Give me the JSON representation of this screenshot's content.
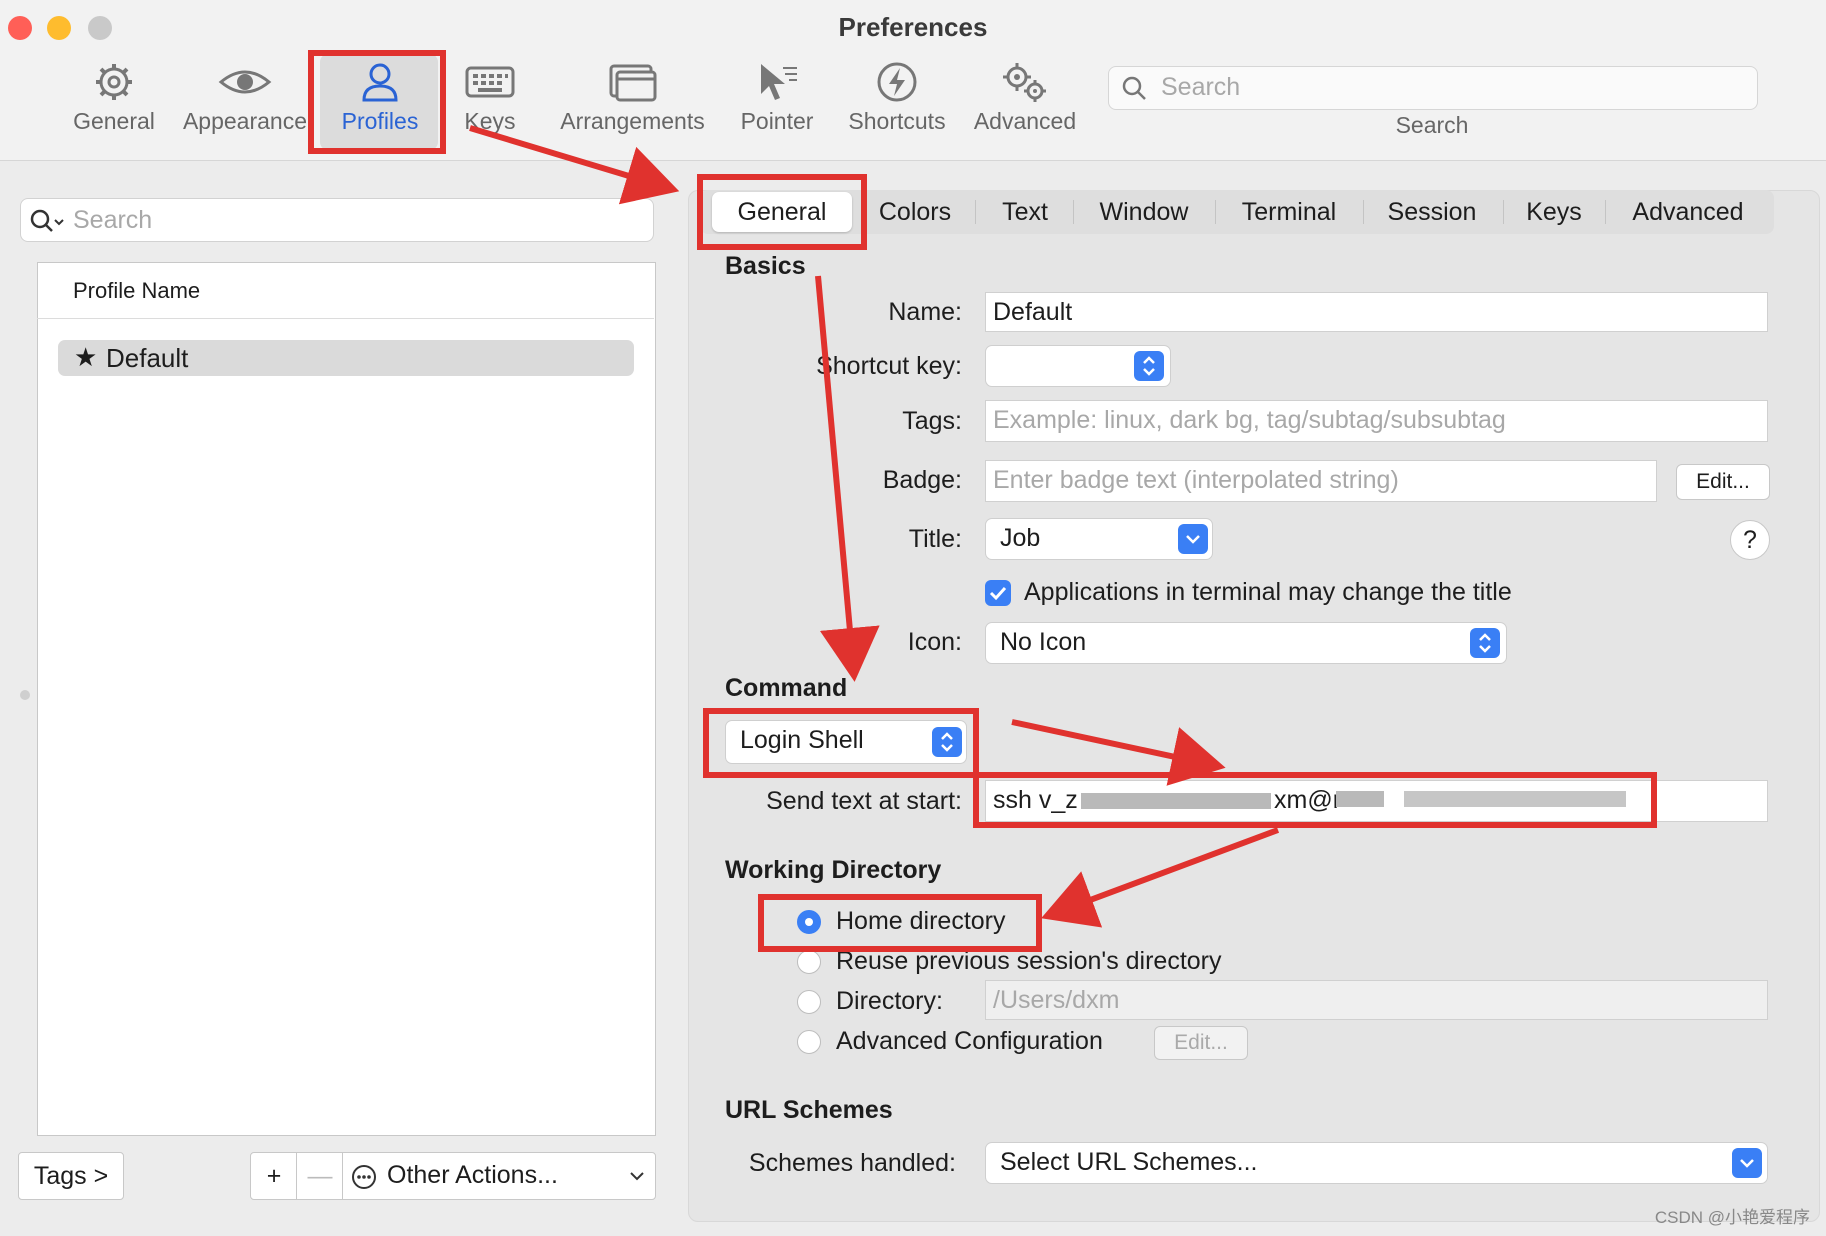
{
  "window": {
    "title": "Preferences"
  },
  "toolbar": {
    "items": [
      {
        "label": "General",
        "icon": "gear-icon"
      },
      {
        "label": "Appearance",
        "icon": "eye-icon"
      },
      {
        "label": "Profiles",
        "icon": "person-icon"
      },
      {
        "label": "Keys",
        "icon": "keyboard-icon"
      },
      {
        "label": "Arrangements",
        "icon": "windows-icon"
      },
      {
        "label": "Pointer",
        "icon": "pointer-icon"
      },
      {
        "label": "Shortcuts",
        "icon": "bolt-icon"
      },
      {
        "label": "Advanced",
        "icon": "gears-icon"
      }
    ],
    "search_placeholder": "Search",
    "search_label": "Search"
  },
  "left": {
    "search_placeholder": "Search",
    "column_header": "Profile Name",
    "profiles": [
      {
        "name": "Default",
        "star": "★"
      }
    ],
    "tags_button": "Tags >",
    "add_button": "+",
    "remove_button": "—",
    "other_actions": "Other Actions..."
  },
  "tabs": [
    "General",
    "Colors",
    "Text",
    "Window",
    "Terminal",
    "Session",
    "Keys",
    "Advanced"
  ],
  "basics": {
    "title": "Basics",
    "name_label": "Name:",
    "name_value": "Default",
    "shortcut_label": "Shortcut key:",
    "tags_label": "Tags:",
    "tags_placeholder": "Example: linux, dark bg, tag/subtag/subsubtag",
    "badge_label": "Badge:",
    "badge_placeholder": "Enter badge text (interpolated string)",
    "badge_edit": "Edit...",
    "title_label": "Title:",
    "title_value": "Job",
    "help": "?",
    "apps_change_title": "Applications in terminal may change the title",
    "icon_label": "Icon:",
    "icon_value": "No Icon"
  },
  "command": {
    "title": "Command",
    "shell_value": "Login Shell",
    "send_text_label": "Send text at start:",
    "send_text_prefix": "ssh v_z",
    "send_text_mid": "xm@r"
  },
  "working_dir": {
    "title": "Working Directory",
    "home": "Home directory",
    "reuse": "Reuse previous session's directory",
    "directory": "Directory:",
    "directory_value": "/Users/dxm",
    "advanced": "Advanced Configuration",
    "advanced_edit": "Edit..."
  },
  "url_schemes": {
    "title": "URL Schemes",
    "label": "Schemes handled:",
    "value": "Select URL Schemes..."
  },
  "watermark": "CSDN @小艳爱程序",
  "colors": {
    "accent": "#3a7ff5",
    "annotation_red": "#e0322e",
    "selected_blue": "#2a63d4"
  }
}
